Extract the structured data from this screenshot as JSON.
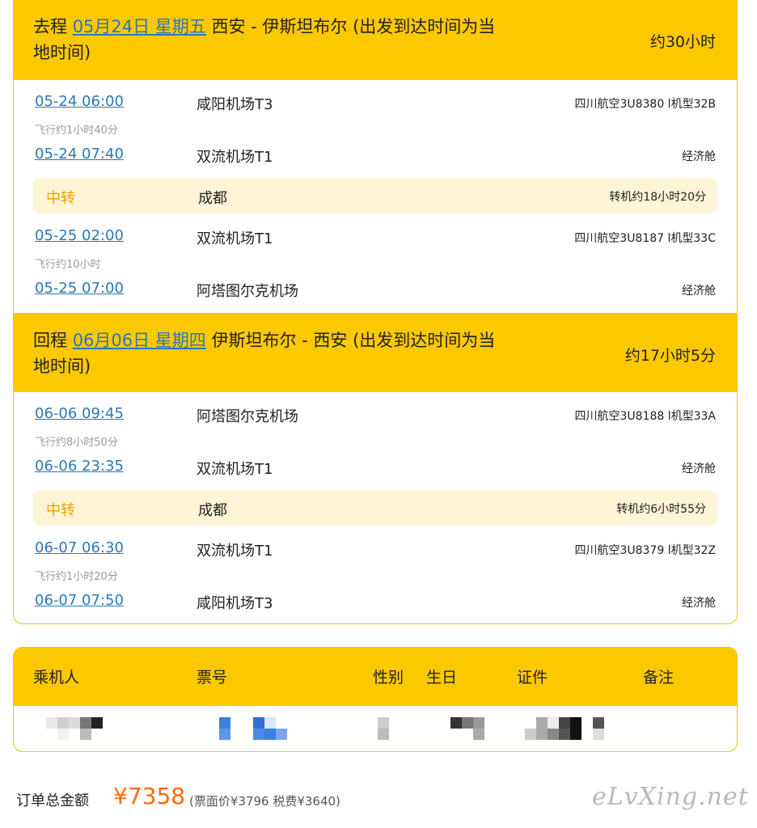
{
  "outbound": {
    "label": "去程",
    "date": "05月24日 星期五",
    "route": "西安 - 伊斯坦布尔 (出发到达时间为当地时间)",
    "duration": "约30小时",
    "legs": [
      {
        "dep_time": "05-24 06:00",
        "dep_airport": "咸阳机场T3",
        "flight": "四川航空3U8380 l机型32B",
        "fly_time": "飞行约1小时40分",
        "arr_time": "05-24 07:40",
        "arr_airport": "双流机场T1",
        "cabin": "经济舱"
      },
      {
        "dep_time": "05-25 02:00",
        "dep_airport": "双流机场T1",
        "flight": "四川航空3U8187 l机型33C",
        "fly_time": "飞行约10小时",
        "arr_time": "05-25 07:00",
        "arr_airport": "阿塔图尔克机场",
        "cabin": "经济舱"
      }
    ],
    "transfer": {
      "label": "中转",
      "city": "成都",
      "wait": "转机约18小时20分"
    }
  },
  "return": {
    "label": "回程",
    "date": "06月06日 星期四",
    "route": "伊斯坦布尔 - 西安 (出发到达时间为当地时间)",
    "duration": "约17小时5分",
    "legs": [
      {
        "dep_time": "06-06 09:45",
        "dep_airport": "阿塔图尔克机场",
        "flight": "四川航空3U8188 l机型33A",
        "fly_time": "飞行约8小时50分",
        "arr_time": "06-06 23:35",
        "arr_airport": "双流机场T1",
        "cabin": "经济舱"
      },
      {
        "dep_time": "06-07 06:30",
        "dep_airport": "双流机场T1",
        "flight": "四川航空3U8379 l机型32Z",
        "fly_time": "飞行约1小时20分",
        "arr_time": "06-07 07:50",
        "arr_airport": "咸阳机场T3",
        "cabin": "经济舱"
      }
    ],
    "transfer": {
      "label": "中转",
      "city": "成都",
      "wait": "转机约6小时55分"
    }
  },
  "passenger_table": {
    "headers": [
      "乘机人",
      "票号",
      "性别",
      "生日",
      "证件",
      "备注"
    ]
  },
  "order": {
    "total_label": "订单总金额",
    "total_amount": "¥7358",
    "breakdown": "(票面价¥3796 税费¥3640)"
  },
  "watermark": "eLvXing.net",
  "colors": {
    "header_bg": "#fcc800",
    "link": "#2b78b8",
    "transfer_bg": "#fdf5d6",
    "transfer_label": "#e8a400",
    "price": "#ff6a00"
  }
}
